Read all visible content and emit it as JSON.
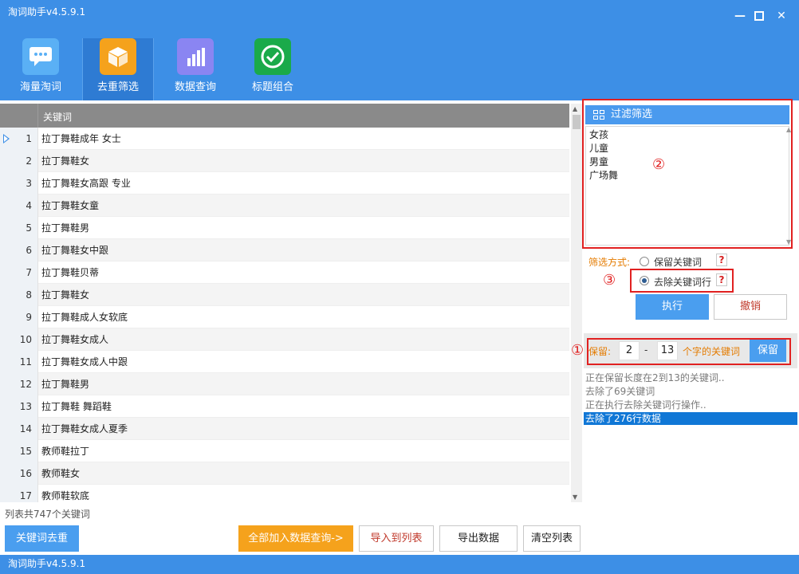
{
  "app": {
    "title": "淘词助手v4.5.9.1"
  },
  "nav": [
    {
      "label": "海量淘词",
      "icon": "chat-icon",
      "color": "#3d8fe6"
    },
    {
      "label": "去重筛选",
      "icon": "box-icon",
      "color": "#f5a21c"
    },
    {
      "label": "数据查询",
      "icon": "bar-chart-icon",
      "color": "#8a85f2"
    },
    {
      "label": "标题组合",
      "icon": "check-circle-icon",
      "color": "#1aaa4a"
    }
  ],
  "grid": {
    "column_header": "关键词",
    "rows": [
      {
        "num": "1",
        "keyword": "拉丁舞鞋成年 女士"
      },
      {
        "num": "2",
        "keyword": "拉丁舞鞋女"
      },
      {
        "num": "3",
        "keyword": "拉丁舞鞋女高跟 专业"
      },
      {
        "num": "4",
        "keyword": "拉丁舞鞋女童"
      },
      {
        "num": "5",
        "keyword": "拉丁舞鞋男"
      },
      {
        "num": "6",
        "keyword": "拉丁舞鞋女中跟"
      },
      {
        "num": "7",
        "keyword": "拉丁舞鞋贝蒂"
      },
      {
        "num": "8",
        "keyword": "拉丁舞鞋女"
      },
      {
        "num": "9",
        "keyword": "拉丁舞鞋成人女软底"
      },
      {
        "num": "10",
        "keyword": "拉丁舞鞋女成人"
      },
      {
        "num": "11",
        "keyword": "拉丁舞鞋女成人中跟"
      },
      {
        "num": "12",
        "keyword": "拉丁舞鞋男"
      },
      {
        "num": "13",
        "keyword": "拉丁舞鞋 舞蹈鞋"
      },
      {
        "num": "14",
        "keyword": "拉丁舞鞋女成人夏季"
      },
      {
        "num": "15",
        "keyword": "教师鞋拉丁"
      },
      {
        "num": "16",
        "keyword": "教师鞋女"
      },
      {
        "num": "17",
        "keyword": "教师鞋软底"
      }
    ]
  },
  "filter": {
    "title": "过滤筛选",
    "words": [
      "女孩",
      "儿童",
      "男童",
      "广场舞"
    ],
    "mode_label": "筛选方式:",
    "option_keep": "保留关键词",
    "option_remove": "去除关键词行",
    "help": "?",
    "execute": "执行",
    "undo": "撤销"
  },
  "keep": {
    "label": "保留:",
    "min": "2",
    "dash": "-",
    "max": "13",
    "suffix": "个字的关键词",
    "button": "保留"
  },
  "log": [
    "正在保留长度在2到13的关键词..",
    "去除了69关键词",
    "正在执行去除关键词行操作..",
    "去除了276行数据"
  ],
  "annotations": [
    "①",
    "②",
    "③"
  ],
  "footer": {
    "count": "列表共747个关键词",
    "dedupe": "关键词去重",
    "add_all": "全部加入数据查询->",
    "import": "导入到列表",
    "export": "导出数据",
    "clear": "清空列表",
    "status": "淘词助手v4.5.9.1"
  }
}
